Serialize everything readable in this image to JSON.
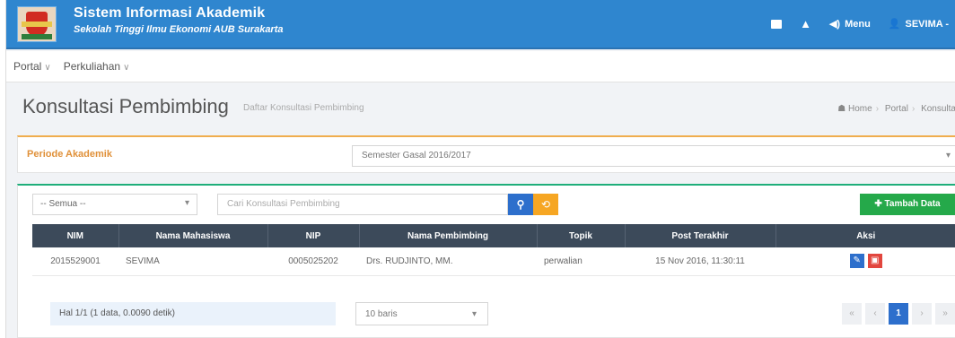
{
  "header": {
    "title": "Sistem Informasi Akademik",
    "subtitle": "Sekolah Tinggi Ilmu Ekonomi AUB Surakarta",
    "nav": {
      "menu": "Menu",
      "user": "SEVIMA -"
    }
  },
  "menubar": {
    "items": [
      "Portal",
      "Perkuliahan"
    ]
  },
  "page": {
    "title": "Konsultasi Pembimbing",
    "subtitle": "Daftar Konsultasi Pembimbing",
    "breadcrumb": [
      "Home",
      "Portal",
      "Konsulta"
    ]
  },
  "periode": {
    "label": "Periode Akademik",
    "value": "Semester Gasal 2016/2017"
  },
  "toolbar": {
    "filter_value": "-- Semua --",
    "search_placeholder": "Cari Konsultasi Pembimbing",
    "add_label": "Tambah Data"
  },
  "table": {
    "headers": [
      "NIM",
      "Nama Mahasiswa",
      "NIP",
      "Nama Pembimbing",
      "Topik",
      "Post Terakhir",
      "Aksi"
    ],
    "rows": [
      [
        "2015529001",
        "SEVIMA",
        "0005025202",
        "Drs. RUDJINTO, MM.",
        "perwalian",
        "15 Nov 2016, 11:30:11"
      ]
    ]
  },
  "footer": {
    "info": "Hal 1/1 (1 data, 0.0090 detik)",
    "per_page": "10 baris",
    "pager": [
      "«",
      "‹",
      "1",
      "›",
      "»"
    ]
  },
  "colors": {
    "header_bg": "#2f86cf",
    "table_header": "#3c4a5a",
    "add_button": "#25a94a",
    "search_button": "#2d6fcc",
    "reset_button": "#f6a623",
    "periode_accent": "#f0ad4e"
  }
}
